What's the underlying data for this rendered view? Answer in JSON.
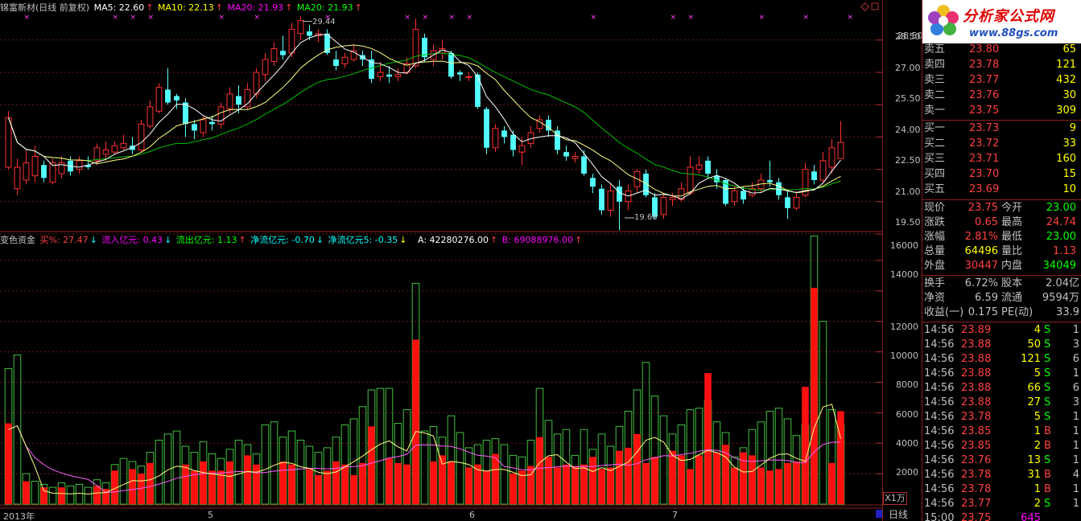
{
  "header": {
    "title": "锦富新材(日线 前复权)",
    "ma": [
      {
        "label": "MA5: 22.60",
        "color": "#ffffff"
      },
      {
        "label": "MA10: 22.13",
        "color": "#ffff00"
      },
      {
        "label": "MA20: 21.93",
        "color": "#ff00ff"
      },
      {
        "label": "MA20: 21.93",
        "color": "#00ff00"
      }
    ]
  },
  "indicator": {
    "name": "变色资金",
    "items": [
      {
        "label": "买%: 27.47",
        "color": "#ff4040"
      },
      {
        "label": "流入亿元: 0.43",
        "color": "#ff00ff"
      },
      {
        "label": "流出亿元: 1.13",
        "color": "#00ff00"
      },
      {
        "label": "净流亿元: -0.70",
        "color": "#00ffff"
      },
      {
        "label": "净流亿元5: -0.35",
        "color": "#00ffff"
      },
      {
        "label": "A: 42280276.00",
        "color": "#ffffff"
      },
      {
        "label": "B: 69088976.00",
        "color": "#ff00ff"
      }
    ]
  },
  "price_axis": [
    "28.50",
    "27.00",
    "25.50",
    "24.00",
    "22.50",
    "21.00",
    "19.50"
  ],
  "volume_axis": [
    "16000",
    "14000",
    "12000",
    "10000",
    "8000",
    "6000",
    "4000",
    "2000"
  ],
  "x_labels": [
    "2013年",
    "5",
    "6",
    "7"
  ],
  "annotations": {
    "high": "29.44",
    "low": "19.68"
  },
  "unit_label": "X1万",
  "period_tab": "日线",
  "logo": {
    "text": "分析家公式网",
    "url": "www.88gs.com"
  },
  "quotes": {
    "sell": [
      {
        "name": "卖五",
        "price": "23.80",
        "vol": "65"
      },
      {
        "name": "卖四",
        "price": "23.78",
        "vol": "121"
      },
      {
        "name": "卖三",
        "price": "23.77",
        "vol": "432"
      },
      {
        "name": "卖二",
        "price": "23.76",
        "vol": "30"
      },
      {
        "name": "卖一",
        "price": "23.75",
        "vol": "309"
      }
    ],
    "buy": [
      {
        "name": "买一",
        "price": "23.73",
        "vol": "9"
      },
      {
        "name": "买二",
        "price": "23.72",
        "vol": "33"
      },
      {
        "name": "买三",
        "price": "23.71",
        "vol": "160"
      },
      {
        "name": "买四",
        "price": "23.70",
        "vol": "15"
      },
      {
        "name": "买五",
        "price": "23.69",
        "vol": "10"
      }
    ]
  },
  "stats": [
    {
      "l1": "现价",
      "v1": "23.75",
      "l2": "今开",
      "v2": "23.00",
      "c1": "#ff4040",
      "c2": "#00ff00"
    },
    {
      "l1": "涨跌",
      "v1": "0.65",
      "l2": "最高",
      "v2": "24.74",
      "c1": "#ff4040",
      "c2": "#ff4040"
    },
    {
      "l1": "涨幅",
      "v1": "2.81%",
      "l2": "最低",
      "v2": "23.00",
      "c1": "#ff4040",
      "c2": "#00ff00"
    },
    {
      "l1": "总量",
      "v1": "64496",
      "l2": "量比",
      "v2": "1.13",
      "c1": "#ffff00",
      "c2": "#ff4040"
    },
    {
      "l1": "外盘",
      "v1": "30447",
      "l2": "内盘",
      "v2": "34049",
      "c1": "#ff4040",
      "c2": "#00ff00"
    }
  ],
  "fund": [
    {
      "l1": "换手",
      "v1": "6.72%",
      "l2": "股本",
      "v2": "2.04亿"
    },
    {
      "l1": "净资",
      "v1": "6.59",
      "l2": "流通",
      "v2": "9594万"
    },
    {
      "l1": "收益(一)",
      "v1": "0.175",
      "l2": "PE(动)",
      "v2": "33.9"
    }
  ],
  "ticks": [
    {
      "time": "14:56",
      "price": "23.89",
      "vol": "4",
      "side": "S",
      "n": "1"
    },
    {
      "time": "14:56",
      "price": "23.88",
      "vol": "50",
      "side": "S",
      "n": "3"
    },
    {
      "time": "14:56",
      "price": "23.88",
      "vol": "121",
      "side": "S",
      "n": "6"
    },
    {
      "time": "14:56",
      "price": "23.88",
      "vol": "5",
      "side": "S",
      "n": "1"
    },
    {
      "time": "14:56",
      "price": "23.88",
      "vol": "66",
      "side": "S",
      "n": "6"
    },
    {
      "time": "14:56",
      "price": "23.88",
      "vol": "27",
      "side": "S",
      "n": "3"
    },
    {
      "time": "14:56",
      "price": "23.78",
      "vol": "5",
      "side": "S",
      "n": "1"
    },
    {
      "time": "14:56",
      "price": "23.85",
      "vol": "1",
      "side": "B",
      "n": "1"
    },
    {
      "time": "14:56",
      "price": "23.85",
      "vol": "2",
      "side": "B",
      "n": "1"
    },
    {
      "time": "14:56",
      "price": "23.76",
      "vol": "13",
      "side": "S",
      "n": "1"
    },
    {
      "time": "14:56",
      "price": "23.78",
      "vol": "31",
      "side": "B",
      "n": "4"
    },
    {
      "time": "14:56",
      "price": "23.78",
      "vol": "1",
      "side": "B",
      "n": "1"
    },
    {
      "time": "14:56",
      "price": "23.77",
      "vol": "2",
      "side": "S",
      "n": "1"
    },
    {
      "time": "15:00",
      "price": "23.75",
      "vol": "645",
      "side": "",
      "n": ""
    }
  ],
  "chart_data": {
    "type": "candlestick",
    "price_range": [
      19.5,
      29.5
    ],
    "volume_range": [
      0,
      17000
    ],
    "candles": [
      [
        22.6,
        24.9,
        25.2,
        22.5
      ],
      [
        21.6,
        22.6,
        23.0,
        21.3
      ],
      [
        22.0,
        22.8,
        23.4,
        21.8
      ],
      [
        22.2,
        23.1,
        23.6,
        21.9
      ],
      [
        22.7,
        22.1,
        22.9,
        21.9
      ],
      [
        21.9,
        22.8,
        23.0,
        21.8
      ],
      [
        22.3,
        22.8,
        23.1,
        22.1
      ],
      [
        22.9,
        22.4,
        23.1,
        22.2
      ],
      [
        22.5,
        22.9,
        23.1,
        22.3
      ],
      [
        22.7,
        22.6,
        23.1,
        22.5
      ],
      [
        22.9,
        23.5,
        23.7,
        22.7
      ],
      [
        23.2,
        23.4,
        23.8,
        22.9
      ],
      [
        23.3,
        23.6,
        23.8,
        23.2
      ],
      [
        23.5,
        23.7,
        24.1,
        23.4
      ],
      [
        23.6,
        23.4,
        24.0,
        23.2
      ],
      [
        23.4,
        24.6,
        24.8,
        23.3
      ],
      [
        24.5,
        25.4,
        25.7,
        24.4
      ],
      [
        25.2,
        26.3,
        26.5,
        25.1
      ],
      [
        26.2,
        25.6,
        27.2,
        25.5
      ],
      [
        25.9,
        25.7,
        26.0,
        25.3
      ],
      [
        25.6,
        24.6,
        25.8,
        24.0
      ],
      [
        24.6,
        24.3,
        24.8,
        23.9
      ],
      [
        24.2,
        24.8,
        25.0,
        24.0
      ],
      [
        24.7,
        24.6,
        25.0,
        24.3
      ],
      [
        24.6,
        25.4,
        25.6,
        24.4
      ],
      [
        25.3,
        26.0,
        26.3,
        25.1
      ],
      [
        25.9,
        25.5,
        26.4,
        25.1
      ],
      [
        25.4,
        26.2,
        26.5,
        25.3
      ],
      [
        26.0,
        27.0,
        27.2,
        25.8
      ],
      [
        26.9,
        27.6,
        27.9,
        26.6
      ],
      [
        27.5,
        28.1,
        28.4,
        27.3
      ],
      [
        28.0,
        27.8,
        28.7,
        27.6
      ],
      [
        27.9,
        29.0,
        29.3,
        27.7
      ],
      [
        28.8,
        29.4,
        29.6,
        28.5
      ],
      [
        28.9,
        28.7,
        29.2,
        28.5
      ],
      [
        28.7,
        28.8,
        29.0,
        28.4
      ],
      [
        28.8,
        27.9,
        29.0,
        27.8
      ],
      [
        27.6,
        27.3,
        28.0,
        27.1
      ],
      [
        27.4,
        27.7,
        27.9,
        27.2
      ],
      [
        27.6,
        28.0,
        28.3,
        27.5
      ],
      [
        27.8,
        27.6,
        28.0,
        27.3
      ],
      [
        27.6,
        26.7,
        28.0,
        26.5
      ],
      [
        26.8,
        27.0,
        27.5,
        26.6
      ],
      [
        26.9,
        26.8,
        27.3,
        26.5
      ],
      [
        26.8,
        26.9,
        27.2,
        26.6
      ],
      [
        27.0,
        27.4,
        27.7,
        26.9
      ],
      [
        27.3,
        29.0,
        29.5,
        27.2
      ],
      [
        28.6,
        27.7,
        28.8,
        27.5
      ],
      [
        27.6,
        28.0,
        28.3,
        27.3
      ],
      [
        27.9,
        28.1,
        28.5,
        27.6
      ],
      [
        27.9,
        26.8,
        28.0,
        26.7
      ],
      [
        27.0,
        26.9,
        27.1,
        26.6
      ],
      [
        26.8,
        26.8,
        27.0,
        26.6
      ],
      [
        26.9,
        25.4,
        27.0,
        25.3
      ],
      [
        25.3,
        23.5,
        25.4,
        23.2
      ],
      [
        23.5,
        24.4,
        24.6,
        23.3
      ],
      [
        24.3,
        24.0,
        24.5,
        23.7
      ],
      [
        24.1,
        23.4,
        24.3,
        23.1
      ],
      [
        23.3,
        23.6,
        24.0,
        22.7
      ],
      [
        23.7,
        24.2,
        24.5,
        23.5
      ],
      [
        24.4,
        24.8,
        25.0,
        24.2
      ],
      [
        24.8,
        24.3,
        25.0,
        24.0
      ],
      [
        24.3,
        23.4,
        24.5,
        23.2
      ],
      [
        23.3,
        23.1,
        23.6,
        22.9
      ],
      [
        23.0,
        23.1,
        23.3,
        22.8
      ],
      [
        23.1,
        22.3,
        23.4,
        22.2
      ],
      [
        22.1,
        21.7,
        22.3,
        21.4
      ],
      [
        21.6,
        20.6,
        21.8,
        20.4
      ],
      [
        20.6,
        21.5,
        21.8,
        20.3
      ],
      [
        21.7,
        21.0,
        22.0,
        19.68
      ],
      [
        21.0,
        21.5,
        21.8,
        20.6
      ],
      [
        21.7,
        22.4,
        22.5,
        21.4
      ],
      [
        22.3,
        21.3,
        22.5,
        21.2
      ],
      [
        21.2,
        20.3,
        21.4,
        20.2
      ],
      [
        20.4,
        21.2,
        21.4,
        20.2
      ],
      [
        21.1,
        21.2,
        21.4,
        20.8
      ],
      [
        21.1,
        21.6,
        21.9,
        21.0
      ],
      [
        21.4,
        22.6,
        23.1,
        21.3
      ],
      [
        22.5,
        22.7,
        23.1,
        22.3
      ],
      [
        22.9,
        22.3,
        23.1,
        22.1
      ],
      [
        22.2,
        21.9,
        22.5,
        21.6
      ],
      [
        22.0,
        20.9,
        22.1,
        20.8
      ],
      [
        21.0,
        21.5,
        21.7,
        20.8
      ],
      [
        21.5,
        21.1,
        21.7,
        20.9
      ],
      [
        21.3,
        21.6,
        21.9,
        21.2
      ],
      [
        21.6,
        22.0,
        22.3,
        21.4
      ],
      [
        22.0,
        21.9,
        22.9,
        21.7
      ],
      [
        21.9,
        21.3,
        22.1,
        21.1
      ],
      [
        21.2,
        20.7,
        21.5,
        20.2
      ],
      [
        20.7,
        21.2,
        21.5,
        20.6
      ],
      [
        21.3,
        22.5,
        22.8,
        21.2
      ],
      [
        22.4,
        22.0,
        22.7,
        21.8
      ],
      [
        22.0,
        22.9,
        23.3,
        21.9
      ],
      [
        22.6,
        23.5,
        23.9,
        22.3
      ],
      [
        23.0,
        23.75,
        24.74,
        23.0
      ]
    ],
    "volume_total": [
      8900,
      9800,
      2000,
      1500,
      1300,
      1100,
      1400,
      1200,
      1300,
      1100,
      1600,
      1400,
      2600,
      3000,
      2800,
      2500,
      3400,
      4200,
      4600,
      4800,
      3800,
      3400,
      4100,
      3300,
      3000,
      3600,
      4200,
      3900,
      3300,
      5200,
      5400,
      4400,
      4800,
      4200,
      3800,
      3400,
      3700,
      4400,
      5200,
      5600,
      6400,
      7500,
      7600,
      7600,
      5300,
      6200,
      14500,
      4800,
      5100,
      4400,
      5800,
      4700,
      3700,
      3900,
      4200,
      4300,
      3900,
      3200,
      3100,
      4200,
      7600,
      5500,
      4600,
      4900,
      3200,
      4900,
      3600,
      4600,
      3800,
      5100,
      6100,
      7500,
      9300,
      7100,
      5800,
      4600,
      5200,
      6200,
      6300,
      6800,
      5400,
      4700,
      3100,
      3700,
      4900,
      5400,
      6100,
      6300,
      5600,
      4500,
      5200,
      17600,
      12000,
      6200,
      5200,
      4100,
      16700,
      15800
    ],
    "volume_red": [
      5300,
      0,
      1500,
      0,
      1100,
      0,
      1100,
      0,
      0,
      0,
      1200,
      1000,
      2200,
      0,
      2300,
      2000,
      2700,
      0,
      0,
      0,
      2600,
      2200,
      2800,
      2200,
      2200,
      2800,
      0,
      3200,
      2600,
      0,
      0,
      2800,
      2600,
      0,
      2300,
      1900,
      2200,
      2800,
      2600,
      1900,
      2700,
      5100,
      0,
      3000,
      2700,
      2600,
      10800,
      0,
      2800,
      3200,
      2800,
      0,
      2400,
      2600,
      2200,
      3300,
      0,
      2000,
      2200,
      2500,
      4400,
      3100,
      2400,
      2600,
      2500,
      2600,
      3100,
      2300,
      2400,
      3500,
      3700,
      4600,
      2700,
      3100,
      0,
      3500,
      3200,
      2300,
      3200,
      8600,
      3400,
      3900,
      2400,
      3400,
      3200,
      2400,
      2200,
      2300,
      2700,
      2800,
      7700,
      14200,
      0,
      2700,
      6100,
      4200
    ],
    "series": [
      {
        "name": "MA5",
        "color": "#ffffff"
      },
      {
        "name": "MA10",
        "color": "#ffff00"
      },
      {
        "name": "MA20",
        "color": "#ff00ff"
      },
      {
        "name": "MA20",
        "color": "#00ff00"
      }
    ]
  }
}
